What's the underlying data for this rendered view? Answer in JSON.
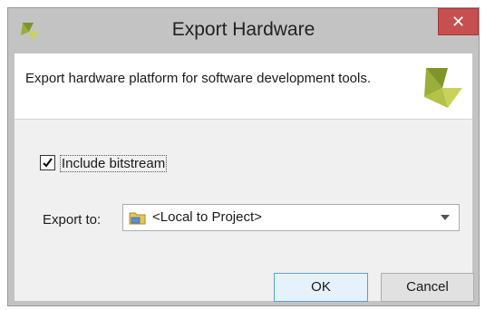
{
  "window": {
    "title": "Export Hardware",
    "close_glyph": "✕"
  },
  "header": {
    "description": "Export hardware platform for software development tools."
  },
  "options": {
    "include_bitstream_label": "Include bitstream",
    "include_bitstream_checked": true,
    "export_to_label": "Export to:",
    "export_to_value": "<Local to Project>"
  },
  "buttons": {
    "ok_label": "OK",
    "cancel_label": "Cancel"
  },
  "icons": {
    "title_logo": "vivado-logo-icon",
    "header_logo": "vivado-logo-icon",
    "combo_icon": "folder-icon",
    "combo_arrow": "chevron-down-icon",
    "checkmark": "checkmark-icon"
  },
  "colors": {
    "close_button": "#c74f4f",
    "logo_green": "#a6b63a",
    "focus_border": "#5b9fd6"
  }
}
